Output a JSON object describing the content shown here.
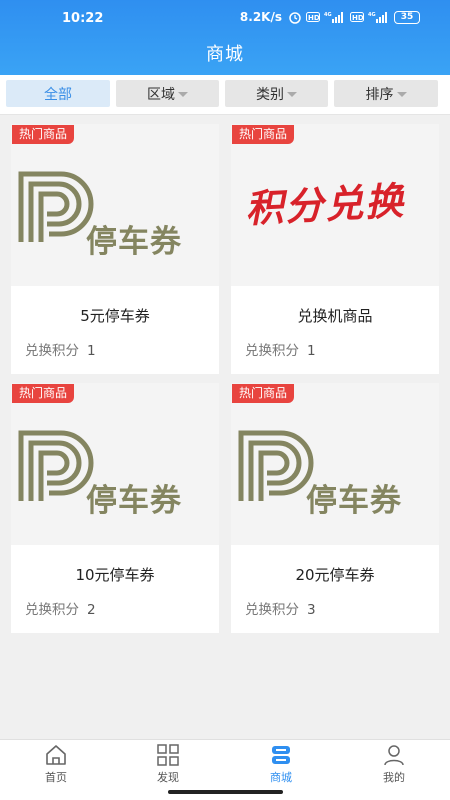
{
  "status": {
    "time": "10:22",
    "net_speed": "8.2K/s",
    "battery": "35"
  },
  "header": {
    "title": "商城"
  },
  "filters": [
    {
      "label": "全部",
      "active": true
    },
    {
      "label": "区域",
      "dropdown": true
    },
    {
      "label": "类别",
      "dropdown": true
    },
    {
      "label": "排序",
      "dropdown": true
    }
  ],
  "products": [
    {
      "badge": "热门商品",
      "image_text": "停车券",
      "image_type": "parking",
      "name": "5元停车券",
      "points_label": "兑换积分",
      "points": "1"
    },
    {
      "badge": "热门商品",
      "image_text": "积分兑换",
      "image_type": "exchange",
      "name": "兑换机商品",
      "points_label": "兑换积分",
      "points": "1"
    },
    {
      "badge": "热门商品",
      "image_text": "停车券",
      "image_type": "parking",
      "name": "10元停车券",
      "points_label": "兑换积分",
      "points": "2"
    },
    {
      "badge": "热门商品",
      "image_text": "停车券",
      "image_type": "parking",
      "name": "20元停车券",
      "points_label": "兑换积分",
      "points": "3"
    }
  ],
  "nav": [
    {
      "label": "首页",
      "icon": "home-icon"
    },
    {
      "label": "发现",
      "icon": "grid-icon"
    },
    {
      "label": "商城",
      "icon": "store-icon",
      "active": true
    },
    {
      "label": "我的",
      "icon": "user-icon"
    }
  ],
  "colors": {
    "accent": "#2f8ff0",
    "badge": "#e8443f",
    "parking": "#848560",
    "exchange": "#d8222a"
  }
}
